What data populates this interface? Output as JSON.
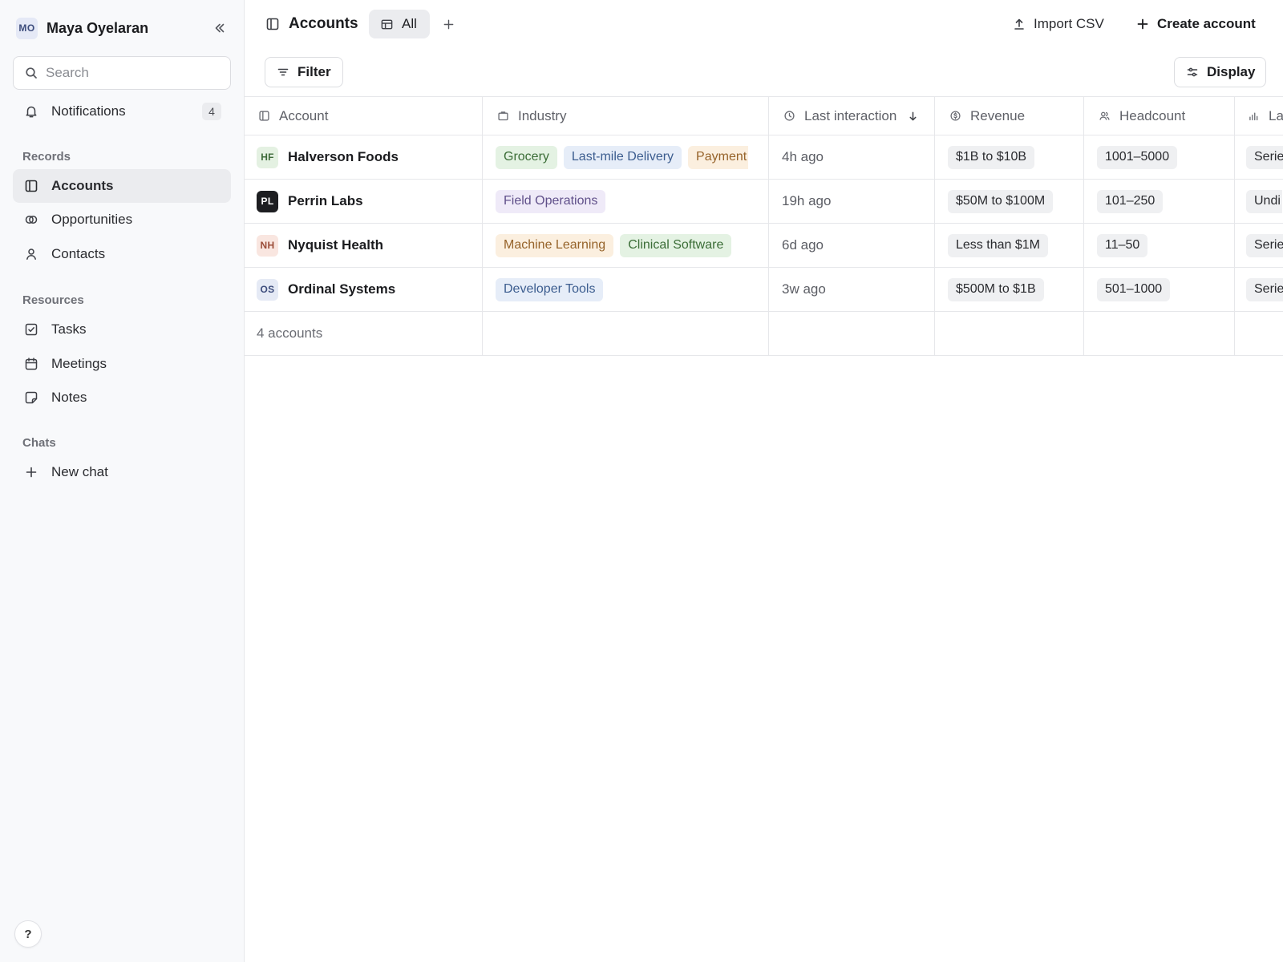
{
  "user": {
    "initials": "MO",
    "name": "Maya Oyelaran"
  },
  "search": {
    "placeholder": "Search"
  },
  "nav": {
    "notifications": {
      "label": "Notifications",
      "count": "4"
    },
    "records_label": "Records",
    "records": [
      {
        "label": "Accounts",
        "icon": "sidebar-panel-icon"
      },
      {
        "label": "Opportunities",
        "icon": "rings-icon"
      },
      {
        "label": "Contacts",
        "icon": "person-icon"
      }
    ],
    "resources_label": "Resources",
    "resources": [
      {
        "label": "Tasks",
        "icon": "checkbox-icon"
      },
      {
        "label": "Meetings",
        "icon": "calendar-icon"
      },
      {
        "label": "Notes",
        "icon": "note-icon"
      }
    ],
    "chats_label": "Chats",
    "new_chat": "New chat"
  },
  "help": {
    "label": "?"
  },
  "topbar": {
    "title": "Accounts",
    "view_tab": "All",
    "import": "Import CSV",
    "create": "Create account",
    "filter": "Filter",
    "display": "Display"
  },
  "table": {
    "columns": [
      {
        "label": "Account",
        "icon": "sidebar-panel-icon"
      },
      {
        "label": "Industry",
        "icon": "briefcase-icon"
      },
      {
        "label": "Last interaction",
        "icon": "clock-icon",
        "sort": "descending"
      },
      {
        "label": "Revenue",
        "icon": "dollar-circle-icon"
      },
      {
        "label": "Headcount",
        "icon": "people-icon"
      },
      {
        "label": "La",
        "icon": "bar-chart-icon"
      }
    ],
    "rows": [
      {
        "initials": "HF",
        "avatar_bg": "#e4f1e2",
        "avatar_fg": "#3e6b3a",
        "name": "Halverson Foods",
        "industries": [
          {
            "label": "Grocery",
            "bg": "#e4f2e3",
            "fg": "#3b6d37"
          },
          {
            "label": "Last-mile Delivery",
            "bg": "#e6edf8",
            "fg": "#3c5d8f"
          },
          {
            "label": "Payment",
            "bg": "#fbefdf",
            "fg": "#96632a"
          }
        ],
        "last_interaction": "4h ago",
        "revenue": "$1B to $10B",
        "headcount": "1001–5000",
        "last_col": "Serie"
      },
      {
        "initials": "PL",
        "avatar_bg": "#1d1e21",
        "avatar_fg": "#ffffff",
        "name": "Perrin Labs",
        "industries": [
          {
            "label": "Field Operations",
            "bg": "#efeaf8",
            "fg": "#60508a"
          }
        ],
        "last_interaction": "19h ago",
        "revenue": "$50M to $100M",
        "headcount": "101–250",
        "last_col": "Undi"
      },
      {
        "initials": "NH",
        "avatar_bg": "#f9e6e0",
        "avatar_fg": "#9a4c38",
        "name": "Nyquist Health",
        "industries": [
          {
            "label": "Machine Learning",
            "bg": "#fbefdf",
            "fg": "#96632a"
          },
          {
            "label": "Clinical Software",
            "bg": "#e4f2e3",
            "fg": "#3b6d37"
          }
        ],
        "last_interaction": "6d ago",
        "revenue": "Less than $1M",
        "headcount": "11–50",
        "last_col": "Serie"
      },
      {
        "initials": "OS",
        "avatar_bg": "#e5eaf5",
        "avatar_fg": "#3d4d7c",
        "name": "Ordinal Systems",
        "industries": [
          {
            "label": "Developer Tools",
            "bg": "#e6edf8",
            "fg": "#3c5d8f"
          }
        ],
        "last_interaction": "3w ago",
        "revenue": "$500M to $1B",
        "headcount": "501–1000",
        "last_col": "Serie"
      }
    ],
    "footer": "4 accounts"
  }
}
